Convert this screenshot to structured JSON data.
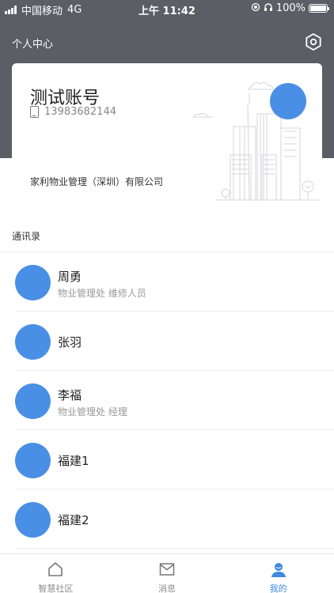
{
  "status_bar": {
    "carrier": "中国移动",
    "network": "4G",
    "time": "上午 11:42",
    "battery": "100%"
  },
  "header": {
    "title": "个人中心",
    "settings_icon": "hexagon-gear-icon"
  },
  "profile": {
    "account_name": "测试账号",
    "phone": "13983682144",
    "company": "家利物业管理（深圳）有限公司",
    "avatar_color": "#4a8fe6"
  },
  "contacts": {
    "section_title": "通讯录",
    "items": [
      {
        "name": "周勇",
        "subtitle": "物业管理处 维修人员"
      },
      {
        "name": "张羽",
        "subtitle": ""
      },
      {
        "name": "李福",
        "subtitle": "物业管理处 经理"
      },
      {
        "name": "福建1",
        "subtitle": ""
      },
      {
        "name": "福建2",
        "subtitle": ""
      }
    ]
  },
  "tabbar": {
    "active_color": "#3d8ae0",
    "items": [
      {
        "label": "智慧社区",
        "icon": "home-icon"
      },
      {
        "label": "消息",
        "icon": "mail-icon"
      },
      {
        "label": "我的",
        "icon": "user-icon"
      }
    ]
  },
  "colors": {
    "header_bg": "#5d5d66",
    "avatar": "#4a8fe6",
    "accent": "#3d8ae0"
  }
}
